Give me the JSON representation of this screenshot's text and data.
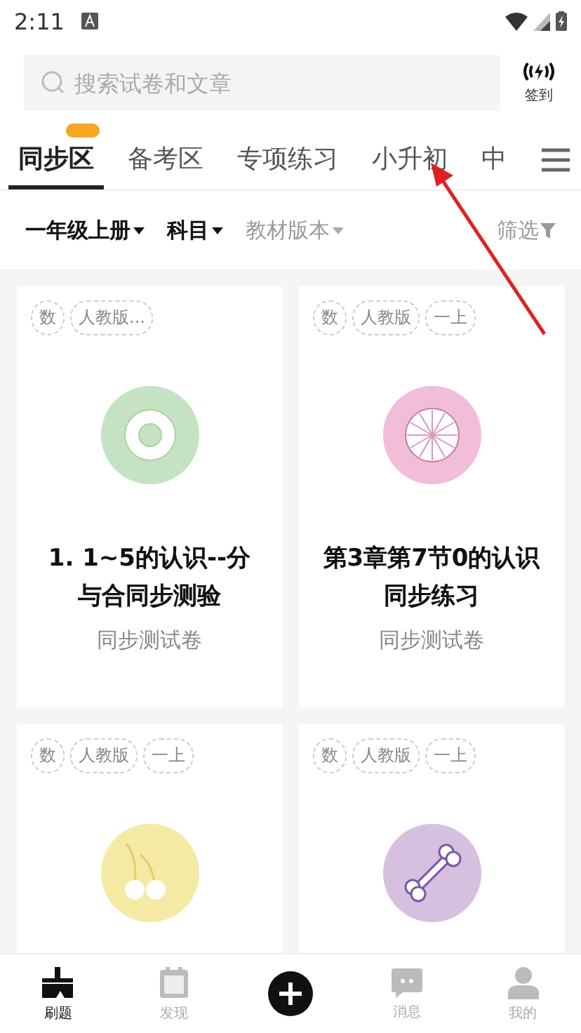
{
  "status_bar": {
    "time": "2:11"
  },
  "search": {
    "placeholder": "搜索试卷和文章"
  },
  "checkin": {
    "label": "签到"
  },
  "tabs": [
    {
      "label": "同步区",
      "selected": true,
      "badge": true
    },
    {
      "label": "备考区",
      "selected": false,
      "badge": false
    },
    {
      "label": "专项练习",
      "selected": false,
      "badge": false
    },
    {
      "label": "小升初",
      "selected": false,
      "badge": false
    },
    {
      "label": "中",
      "selected": false,
      "badge": false
    }
  ],
  "filters": [
    {
      "label": "一年级上册",
      "active": true
    },
    {
      "label": "科目",
      "active": true
    },
    {
      "label": "教材版本",
      "active": false
    }
  ],
  "filter_button": {
    "label": "筛选"
  },
  "cards": [
    {
      "tags": [
        "数",
        "人教版..."
      ],
      "kind": "ring",
      "color": "#c5e3c3",
      "title": "1. 1~5的认识--分与合同步测验",
      "subtitle": "同步测试卷"
    },
    {
      "tags": [
        "数",
        "人教版",
        "一上"
      ],
      "kind": "wheel",
      "color": "#f2bdd8",
      "title": "第3章第7节0的认识同步练习",
      "subtitle": "同步测试卷"
    },
    {
      "tags": [
        "数",
        "人教版",
        "一上"
      ],
      "kind": "cherry",
      "color": "#f5eaa4"
    },
    {
      "tags": [
        "数",
        "人教版",
        "一上"
      ],
      "kind": "bone",
      "color": "#d7bfe0"
    }
  ],
  "bottom_nav": [
    {
      "label": "刷题",
      "kind": "brush",
      "selected": true
    },
    {
      "label": "发现",
      "kind": "calendar",
      "selected": false
    },
    {
      "kind": "plus"
    },
    {
      "label": "消息",
      "kind": "chat",
      "selected": false
    },
    {
      "label": "我的",
      "kind": "person",
      "selected": false
    }
  ]
}
